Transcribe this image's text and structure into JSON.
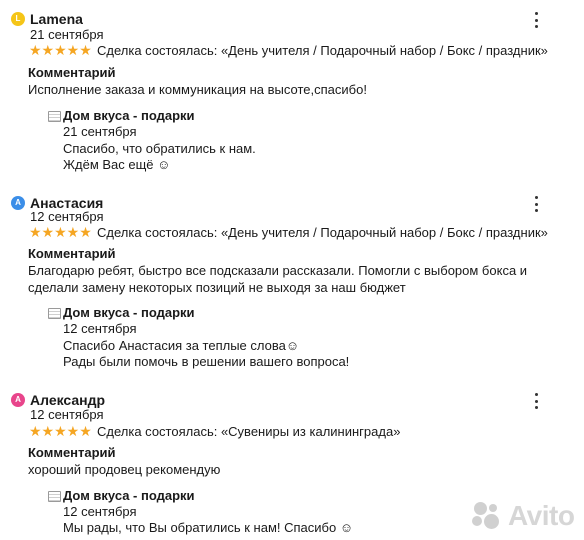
{
  "stars": "★★★★★",
  "reviews": [
    {
      "avatar_letter": "L",
      "avatar_color": "#f5c518",
      "name": "Lamena",
      "date": "21 сентября",
      "deal": "Сделка состоялась: «День учителя / Подарочный набор / Бокс / праздник»",
      "comment_label": "Комментарий",
      "comment": "Исполнение заказа и коммуникация на высоте,спасибо!",
      "reply": {
        "name": "Дом вкуса - подарки",
        "date": "21 сентября",
        "lines": [
          "Спасибо, что обратились к нам.",
          "Ждём Вас ещё ☺"
        ]
      }
    },
    {
      "avatar_letter": "A",
      "avatar_color": "#3b8ee8",
      "name": "Анастасия",
      "date": "12 сентября",
      "deal": "Сделка состоялась: «День учителя / Подарочный набор / Бокс / праздник»",
      "comment_label": "Комментарий",
      "comment": "Благодарю ребят, быстро все подсказали рассказали. Помогли с выбором бокса и сделали замену некоторых позиций не выходя за наш бюджет",
      "reply": {
        "name": "Дом вкуса - подарки",
        "date": "12 сентября",
        "lines": [
          "Спасибо Анастасия за теплые слова☺",
          "Рады были помочь в решении вашего вопроса!"
        ]
      }
    },
    {
      "avatar_letter": "A",
      "avatar_color": "#e8458b",
      "name": "Александр",
      "date": "12 сентября",
      "deal": "Сделка состоялась: «Сувениры из калининграда»",
      "comment_label": "Комментарий",
      "comment": "хороший продовец рекомендую",
      "reply": {
        "name": "Дом вкуса - подарки",
        "date": "12 сентября",
        "lines": [
          "Мы рады, что Вы обратились к нам! Спасибо ☺"
        ]
      }
    }
  ],
  "watermark": "Avito"
}
